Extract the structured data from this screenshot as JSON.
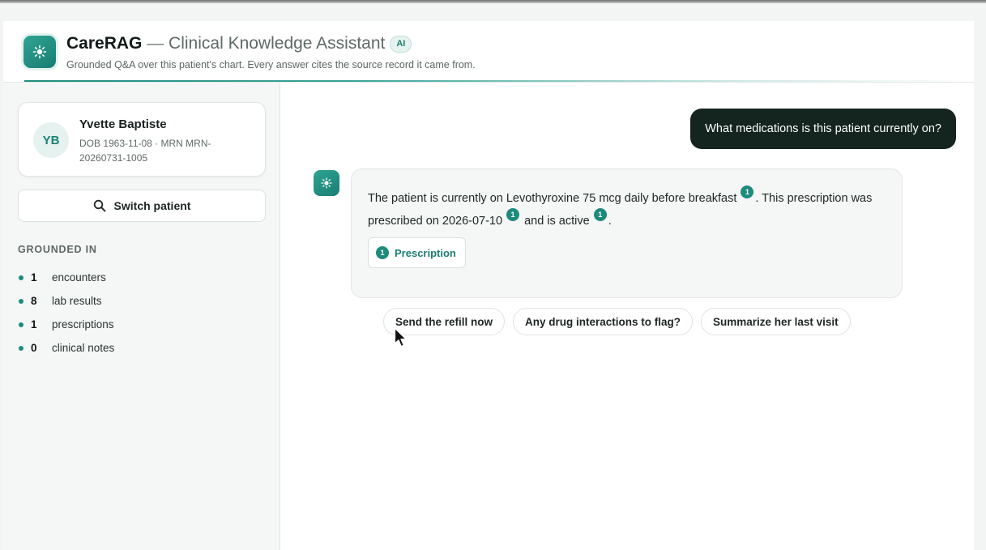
{
  "header": {
    "brand": "CareRAG",
    "separator": " — ",
    "subtitle": "Clinical Knowledge Assistant",
    "ai_badge": "AI",
    "tagline": "Grounded Q&A over this patient's chart. Every answer cites the source record it came from.",
    "logo_icon": "sparkle-sun-icon"
  },
  "patient": {
    "initials": "YB",
    "name": "Yvette Baptiste",
    "meta": "DOB 1963-11-08 · MRN MRN-20260731-1005"
  },
  "sidebar": {
    "switch_label": "Switch patient",
    "grounded_title": "GROUNDED IN",
    "stats": [
      {
        "count": "1",
        "label": "encounters"
      },
      {
        "count": "8",
        "label": "lab results"
      },
      {
        "count": "1",
        "label": "prescriptions"
      },
      {
        "count": "0",
        "label": "clinical notes"
      }
    ]
  },
  "chat": {
    "user_question": "What medications is this patient currently on?",
    "answer": {
      "part1": "The patient is currently on Levothyroxine 75 mcg daily before breakfast",
      "cite1": "1",
      "part2": ". This prescription was prescribed on 2026-07-10",
      "cite2": "1",
      "part3": " and is active",
      "cite3": "1",
      "part4": "."
    },
    "source_chip": {
      "num": "1",
      "label": "Prescription"
    },
    "suggestions": [
      "Send the refill now",
      "Any drug interactions to flag?",
      "Summarize her last visit"
    ]
  },
  "colors": {
    "accent": "#1d8b7c",
    "user_bubble": "#142520",
    "sidebar_bg": "#f5f6f6"
  }
}
